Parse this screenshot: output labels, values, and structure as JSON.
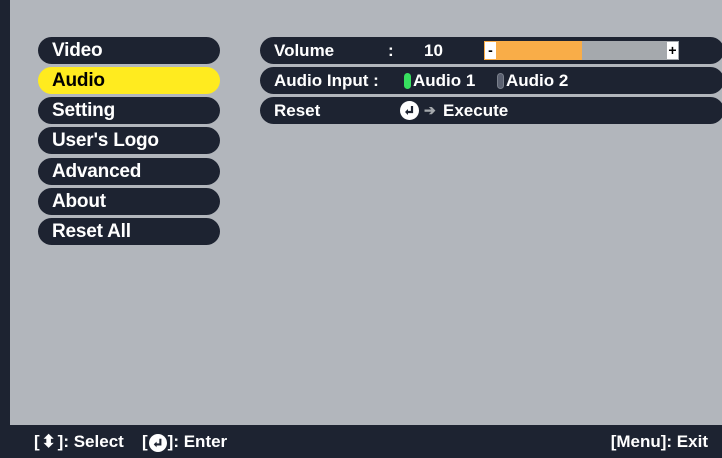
{
  "menu": {
    "items": [
      {
        "label": "Video"
      },
      {
        "label": "Audio"
      },
      {
        "label": "Setting"
      },
      {
        "label": "User's Logo"
      },
      {
        "label": "Advanced"
      },
      {
        "label": "About"
      },
      {
        "label": "Reset All"
      }
    ],
    "selected_index": 1
  },
  "audio": {
    "volume": {
      "label": "Volume",
      "colon": ":",
      "value": "10",
      "level": 0.5,
      "minus": "-",
      "plus": "+"
    },
    "input": {
      "label": "Audio Input :",
      "options": [
        "Audio 1",
        "Audio 2"
      ],
      "selected": "Audio 1"
    },
    "reset": {
      "label": "Reset",
      "action": "Execute"
    }
  },
  "footer": {
    "select_key_open": "[",
    "select_key_close": "]: Select",
    "enter_key_open": "[",
    "enter_key_close": "]: Enter",
    "exit": "[Menu]: Exit"
  },
  "colors": {
    "panel": "#b2b6bc",
    "pill": "#1d2331",
    "selected": "#ffeb1f",
    "volume_fill": "#f9ad48",
    "radio_on": "#37e05f",
    "radio_off": "#5a6070"
  }
}
